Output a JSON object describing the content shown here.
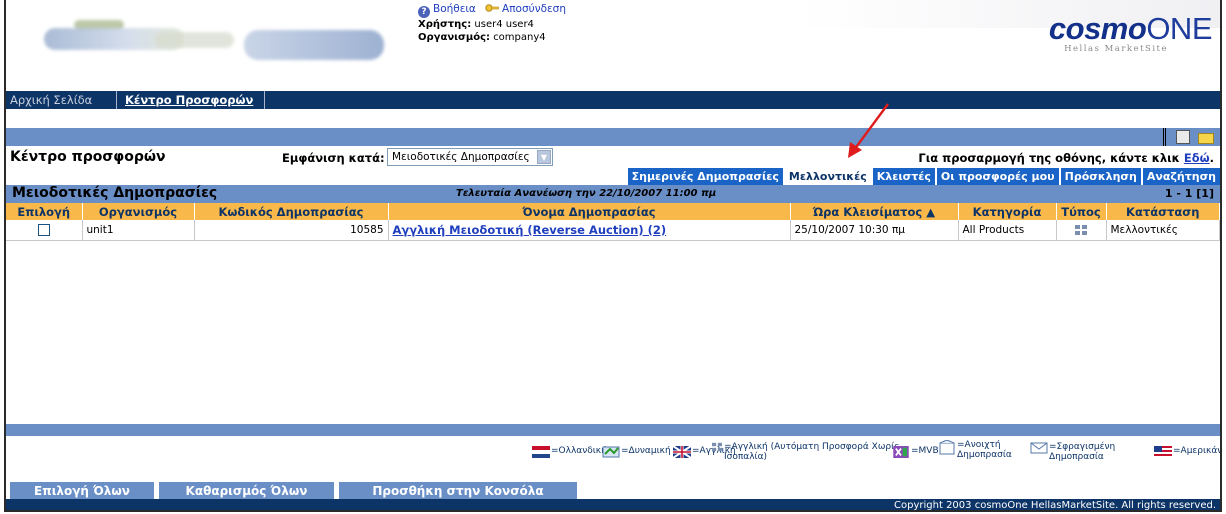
{
  "header": {
    "help_label": "Βοήθεια",
    "logout_label": "Αποσύνδεση",
    "user_label": "Χρήστης:",
    "user_value": "user4 user4",
    "org_label": "Οργανισμός:",
    "org_value": "company4",
    "brand_main": "cosmo",
    "brand_one": "ONE",
    "brand_sub": "Hellas MarketSite"
  },
  "nav": {
    "home": "Αρχική Σελίδα",
    "offers_center": "Κέντρο Προσφορών"
  },
  "page": {
    "title": "Κέντρο προσφορών",
    "view_label": "Εμφάνιση κατά:",
    "view_value": "Μειοδοτικές Δημοπρασίες",
    "adjust_text": "Για προσαρμογή της οθόνης, κάντε κλικ",
    "adjust_link": "Εδώ",
    "adjust_tail": "."
  },
  "tabs": [
    {
      "label": "Σημερινές Δημοπρασίες",
      "active": false
    },
    {
      "label": "Μελλοντικές",
      "active": true
    },
    {
      "label": "Κλειστές",
      "active": false
    },
    {
      "label": "Οι προσφορές μου",
      "active": false
    },
    {
      "label": "Πρόσκληση",
      "active": false
    },
    {
      "label": "Αναζήτηση",
      "active": false
    }
  ],
  "section": {
    "title": "Μειοδοτικές Δημοπρασίες",
    "updated": "Τελευταία Ανανέωση την 22/10/2007 11:00 πμ",
    "pager": "1 - 1 [1]"
  },
  "table": {
    "columns": [
      "Επιλογή",
      "Οργανισμός",
      "Κωδικός Δημοπρασίας",
      "Όνομα Δημοπρασίας",
      "Ώρα Κλεισίματος ▲",
      "Κατηγορία",
      "Τύπος",
      "Κατάσταση"
    ],
    "rows": [
      {
        "org": "unit1",
        "code": "10585",
        "name": "Αγγλική Μειοδοτική (Reverse Auction) (2)",
        "close": "25/10/2007 10:30 πμ",
        "category": "All Products",
        "status": "Μελλοντικές"
      }
    ]
  },
  "legend": {
    "dutch": "=Ολλανδική",
    "dynamic": "=Δυναμική",
    "english": "=Αγγλική",
    "english_auto": "=Αγγλική (Αυτόματη Προσφορά Χωρίς Ισοπαλία)",
    "mvb": "=MVB",
    "open": "=Ανοιχτή Δημοπρασία",
    "sealed": "=Σφραγισμένη Δημοπρασία",
    "american": "=Αμερικάνικη"
  },
  "buttons": {
    "select_all": "Επιλογή Όλων",
    "clear_all": "Καθαρισμός Όλων",
    "add_console": "Προσθήκη στην Κονσόλα"
  },
  "footer": "Copyright 2003 cosmoOne HellasMarketSite. All rights reserved.",
  "colors": {
    "navy": "#0d3467",
    "band": "#6a8fc7",
    "tab": "#1b64c7",
    "header_orange": "#f9b84a",
    "link": "#1f3fbf",
    "arrow": "#e01b1b"
  }
}
